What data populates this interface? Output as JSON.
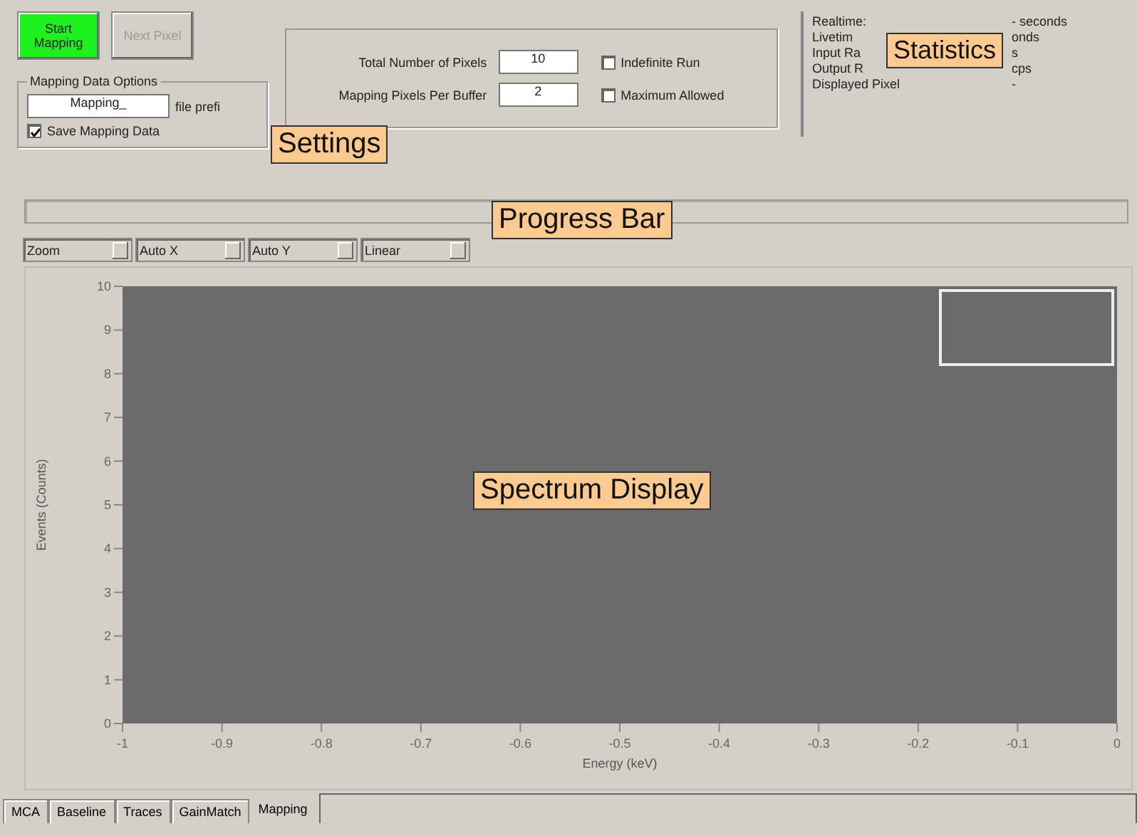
{
  "buttons": [
    {
      "label": "Start Mapping",
      "highlighted": true,
      "disabled": false
    },
    {
      "label": "Next Pixel",
      "highlighted": false,
      "disabled": true
    }
  ],
  "mapping_options": {
    "title": "Mapping Data Options",
    "prefix_field": {
      "value": "Mapping_",
      "label": "file prefi"
    },
    "save_checkbox": {
      "label": "Save Mapping Data",
      "checked": true
    }
  },
  "pixel_settings": [
    {
      "label": "Total Number of Pixels",
      "value": "10",
      "checkbox": {
        "label": "Indefinite Run",
        "checked": false
      }
    },
    {
      "label": "Mapping Pixels Per Buffer",
      "value": "2",
      "checkbox": {
        "label": "Maximum Allowed",
        "checked": false
      }
    }
  ],
  "statistics": [
    {
      "label": "Realtime:",
      "value": "- seconds"
    },
    {
      "label": "Livetim",
      "value": "onds"
    },
    {
      "label": "Input Ra",
      "value": "s"
    },
    {
      "label": "Output R",
      "value": "cps"
    },
    {
      "label": "Displayed Pixel",
      "value": "-"
    }
  ],
  "progress": {
    "level": 0
  },
  "dropdowns": [
    "Zoom",
    "Auto X",
    "Auto Y",
    "Linear"
  ],
  "spectrum": {
    "chart_data": {
      "type": "line",
      "xlabel": "Energy (keV)",
      "ylabel": "Events (Counts)",
      "xlim": [
        -1,
        0
      ],
      "ylim": [
        0,
        10
      ],
      "xticks": [
        -1,
        -0.9,
        -0.8,
        -0.7,
        -0.6,
        -0.5,
        -0.4,
        -0.3,
        -0.2,
        -0.1,
        0
      ],
      "yticks": [
        0,
        1,
        2,
        3,
        4,
        5,
        6,
        7,
        8,
        9,
        10
      ]
    }
  },
  "callouts": [
    "Settings",
    "Statistics",
    "Progress Bar",
    "Spectrum Display"
  ],
  "tabs": [
    {
      "label": "MCA",
      "selected": false
    },
    {
      "label": "Baseline",
      "selected": false
    },
    {
      "label": "Traces",
      "selected": false
    },
    {
      "label": "GainMatch",
      "selected": false
    },
    {
      "label": "Mapping",
      "selected": true
    }
  ]
}
